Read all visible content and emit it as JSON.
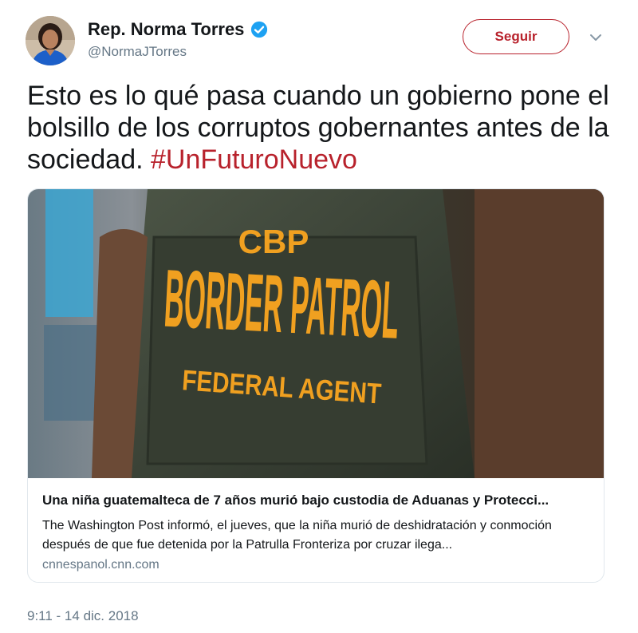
{
  "author": {
    "name": "Rep. Norma Torres",
    "handle": "@NormaJTorres",
    "avatar_icon": "profile-photo",
    "verified_icon": "verified-badge-icon"
  },
  "actions": {
    "follow_label": "Seguir",
    "menu_icon": "chevron-down-icon"
  },
  "tweet": {
    "text": "Esto es lo qué pasa cuando un gobierno pone el bolsillo de los corruptos gobernantes antes de la sociedad. ",
    "hashtag": "#UnFuturoNuevo",
    "timestamp": "9:11 - 14 dic. 2018"
  },
  "card": {
    "image": {
      "patch_line1": "CBP",
      "patch_line2": "BORDER PATROL",
      "patch_line3": "FEDERAL AGENT"
    },
    "title": "Una niña guatemalteca de 7 años murió bajo custodia de Aduanas y Protecci...",
    "description": "The Washington Post informó, el jueves, que la niña murió de deshidratación y conmoción después de que fue detenida por la Patrulla Fronteriza por cruzar ilega...",
    "domain": "cnnespanol.cnn.com"
  },
  "colors": {
    "accent": "#b8222c",
    "verified": "#1da1f2",
    "secondary_text": "#657786",
    "patch_text": "#f0a020"
  }
}
